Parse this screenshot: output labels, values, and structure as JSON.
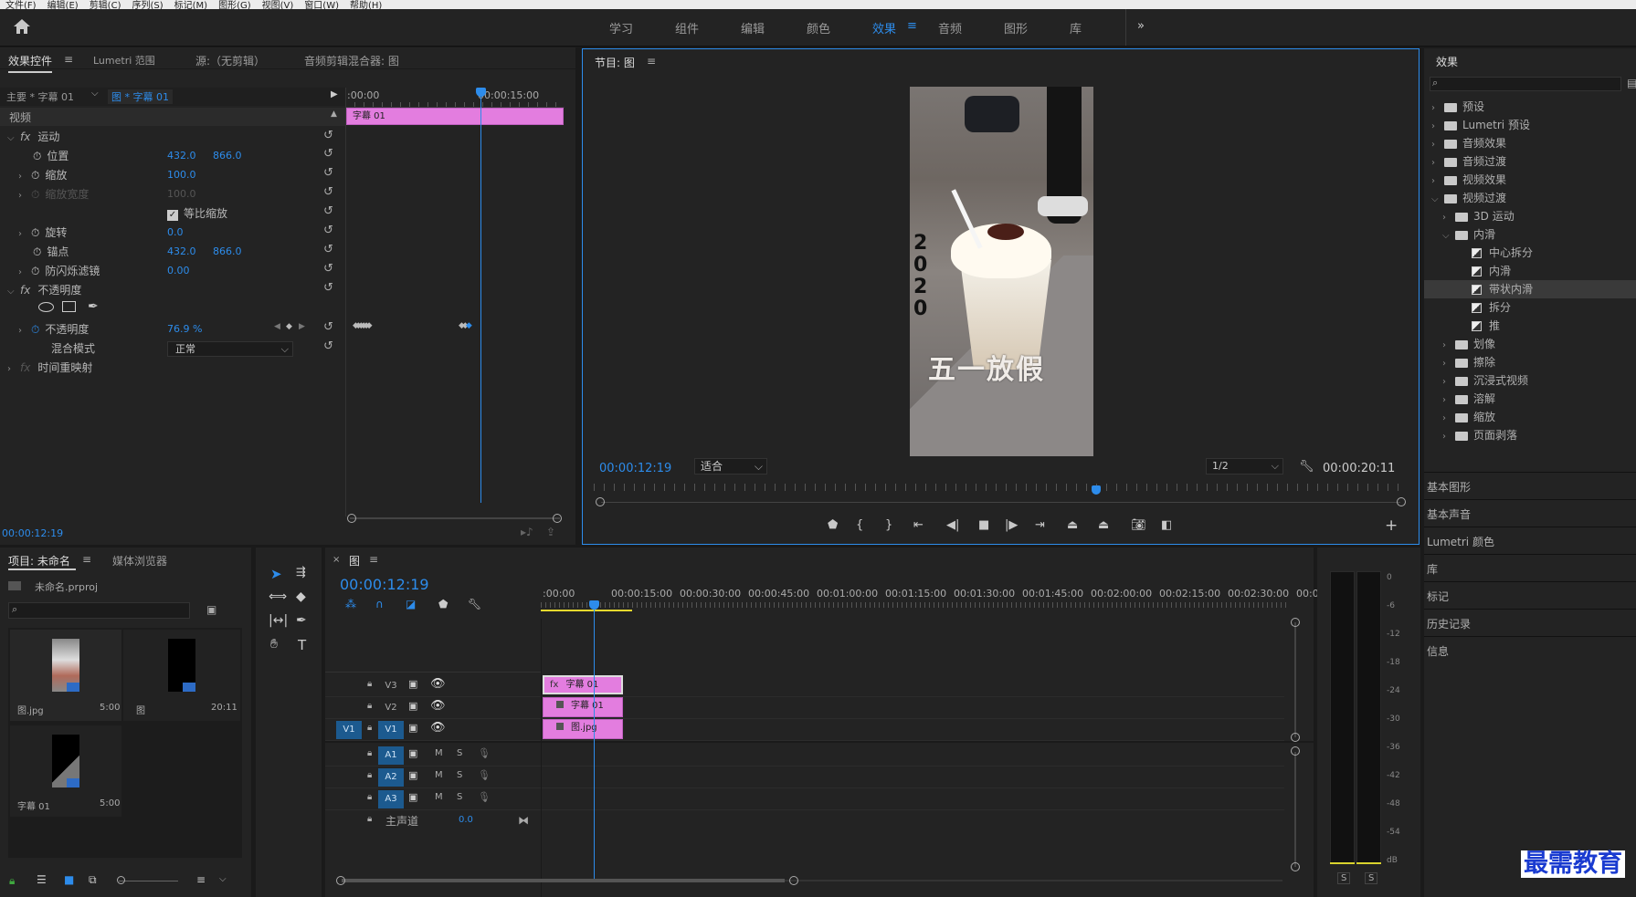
{
  "menubar": [
    "文件(F)",
    "编辑(E)",
    "剪辑(C)",
    "序列(S)",
    "标记(M)",
    "图形(G)",
    "视图(V)",
    "窗口(W)",
    "帮助(H)"
  ],
  "workspaces": [
    "学习",
    "组件",
    "编辑",
    "颜色",
    "效果",
    "音频",
    "图形",
    "库"
  ],
  "active_workspace": "效果",
  "effect_controls": {
    "tabs": [
      "效果控件",
      "Lumetri 范围",
      "源:（无剪辑）",
      "音频剪辑混合器: 图"
    ],
    "master_label": "主要 * 字幕 01",
    "sequence_label": "图 * 字幕 01",
    "ruler_start": ":00:00",
    "ruler_mark": "00:00:15:00",
    "clip_label": "字幕 01",
    "section_video": "视频",
    "motion": "运动",
    "position_label": "位置",
    "position_x": "432.0",
    "position_y": "866.0",
    "scale_label": "缩放",
    "scale_value": "100.0",
    "scale_width_label": "缩放宽度",
    "scale_width_value": "100.0",
    "uniform_scale": "等比缩放",
    "rotation_label": "旋转",
    "rotation_value": "0.0",
    "anchor_label": "锚点",
    "anchor_x": "432.0",
    "anchor_y": "866.0",
    "flicker_label": "防闪烁滤镜",
    "flicker_value": "0.00",
    "opacity_section": "不透明度",
    "opacity_label": "不透明度",
    "opacity_value": "76.9 %",
    "blend_label": "混合模式",
    "blend_value": "正常",
    "time_remap": "时间重映射",
    "timecode": "00:00:12:19"
  },
  "program": {
    "title": "节目: 图",
    "timecode": "00:00:12:19",
    "fit": "适合",
    "resolution": "1/2",
    "duration": "00:00:20:11",
    "vertical_text": [
      "2",
      "0",
      "2",
      "0"
    ],
    "caption": "五一放假"
  },
  "effects": {
    "title": "效果",
    "items": [
      {
        "label": "预设",
        "level": 0,
        "type": "folder",
        "open": false
      },
      {
        "label": "Lumetri 预设",
        "level": 0,
        "type": "folder",
        "open": false
      },
      {
        "label": "音频效果",
        "level": 0,
        "type": "folder",
        "open": false
      },
      {
        "label": "音频过渡",
        "level": 0,
        "type": "folder",
        "open": false
      },
      {
        "label": "视频效果",
        "level": 0,
        "type": "folder",
        "open": false
      },
      {
        "label": "视频过渡",
        "level": 0,
        "type": "folder",
        "open": true
      },
      {
        "label": "3D 运动",
        "level": 1,
        "type": "folder",
        "open": false
      },
      {
        "label": "内滑",
        "level": 1,
        "type": "folder",
        "open": true
      },
      {
        "label": "中心拆分",
        "level": 2,
        "type": "fx"
      },
      {
        "label": "内滑",
        "level": 2,
        "type": "fx"
      },
      {
        "label": "带状内滑",
        "level": 2,
        "type": "fx",
        "selected": true
      },
      {
        "label": "拆分",
        "level": 2,
        "type": "fx"
      },
      {
        "label": "推",
        "level": 2,
        "type": "fx"
      },
      {
        "label": "划像",
        "level": 1,
        "type": "folder",
        "open": false
      },
      {
        "label": "擦除",
        "level": 1,
        "type": "folder",
        "open": false
      },
      {
        "label": "沉浸式视频",
        "level": 1,
        "type": "folder",
        "open": false
      },
      {
        "label": "溶解",
        "level": 1,
        "type": "folder",
        "open": false
      },
      {
        "label": "缩放",
        "level": 1,
        "type": "folder",
        "open": false
      },
      {
        "label": "页面剥落",
        "level": 1,
        "type": "folder",
        "open": false
      }
    ],
    "panels": [
      "基本图形",
      "基本声音",
      "Lumetri 颜色",
      "库",
      "标记",
      "历史记录",
      "信息"
    ]
  },
  "project": {
    "tabs": [
      "项目: 未命名",
      "媒体浏览器"
    ],
    "file": "未命名.prproj",
    "items": [
      {
        "name": "图.jpg",
        "dur": "5:00"
      },
      {
        "name": "图",
        "dur": "20:11"
      },
      {
        "name": "字幕 01",
        "dur": "5:00"
      }
    ]
  },
  "timeline": {
    "tab": "图",
    "timecode": "00:00:12:19",
    "ruler": [
      ":00:00",
      "00:00:15:00",
      "00:00:30:00",
      "00:00:45:00",
      "00:01:00:00",
      "00:01:15:00",
      "00:01:30:00",
      "00:01:45:00",
      "00:02:00:00",
      "00:02:15:00",
      "00:02:30:00",
      "00:02"
    ],
    "tracks_v": [
      "V3",
      "V2",
      "V1"
    ],
    "tracks_a": [
      "A1",
      "A2",
      "A3"
    ],
    "source_v": "V1",
    "master": "主声道",
    "master_value": "0.0",
    "clips": {
      "v3": "字幕 01",
      "v2": "字幕 01",
      "v1": "图.jpg"
    },
    "mute": "M",
    "solo": "S"
  },
  "meter": {
    "scale": [
      "0",
      "-6",
      "-12",
      "-18",
      "-24",
      "-30",
      "-36",
      "-42",
      "-48",
      "-54",
      "dB"
    ],
    "solo": [
      "S",
      "S"
    ]
  },
  "watermark": "最需教育"
}
